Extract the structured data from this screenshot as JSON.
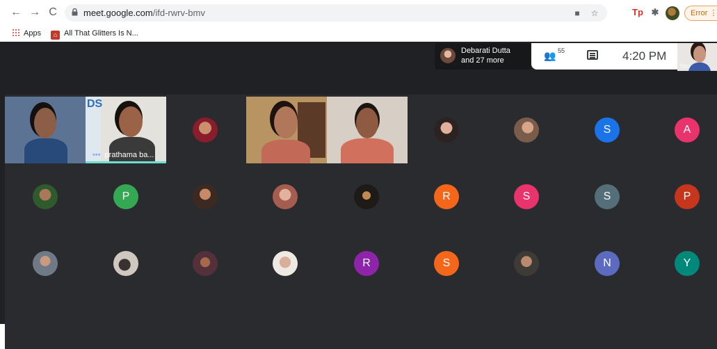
{
  "browser": {
    "url_host": "meet.google.com",
    "url_path": "/ifd-rwrv-bmv",
    "error_label": "Error",
    "nav_back": "←",
    "nav_forward": "→",
    "nav_reload": "C",
    "more_glyph": "⋮"
  },
  "bookmarks": [
    {
      "label": "Apps",
      "icon": "apps-grid-icon"
    },
    {
      "label": "All That Glitters Is N...",
      "icon": "bookmark-favicon"
    }
  ],
  "extensions": [
    {
      "name": "tp-extension-icon",
      "glyph": "Tp",
      "color": "#d93025"
    },
    {
      "name": "puzzle-extension-icon",
      "glyph": "✱",
      "color": "#5f6368"
    }
  ],
  "meet": {
    "joined_notice": {
      "line1": "Debarati Dutta",
      "line2": "and 27 more"
    },
    "people_count": "55",
    "time": "4:20 PM",
    "self_label": "You",
    "featured_name": "prathama ba..."
  },
  "avatars": [
    {
      "letter": "S",
      "color": "#1a73e8"
    },
    {
      "letter": "A",
      "color": "#e8336d"
    },
    {
      "letter": "P",
      "color": "#34a853"
    },
    {
      "letter": "R",
      "color": "#f4661a"
    },
    {
      "letter": "S",
      "color": "#e8336d"
    },
    {
      "letter": "S",
      "color": "#546e7a"
    },
    {
      "letter": "P",
      "color": "#c5361c"
    },
    {
      "letter": "R",
      "color": "#8e24aa"
    },
    {
      "letter": "S",
      "color": "#f4661a"
    },
    {
      "letter": "N",
      "color": "#5c6bc0"
    },
    {
      "letter": "Y",
      "color": "#00897b"
    }
  ]
}
